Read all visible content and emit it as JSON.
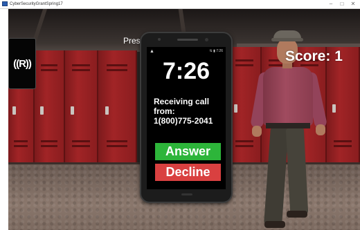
{
  "window": {
    "title": "CyberSecurityGrantSpring17",
    "minimize": "–",
    "maximize": "□",
    "close": "✕"
  },
  "hud": {
    "press_prompt": "Pres",
    "score_label": "Score: 1",
    "radio_button_glyph": "((R))"
  },
  "phone": {
    "status_warning": "▲",
    "status_right": "⇅ ▮ 7:26",
    "time": "7:26",
    "call_text": "Receiving call from:",
    "caller_number": "1(800)775-2041",
    "answer_label": "Answer",
    "decline_label": "Decline"
  },
  "colors": {
    "answer": "#2db53a",
    "decline": "#d94040",
    "lockers": "#8e1e20"
  }
}
